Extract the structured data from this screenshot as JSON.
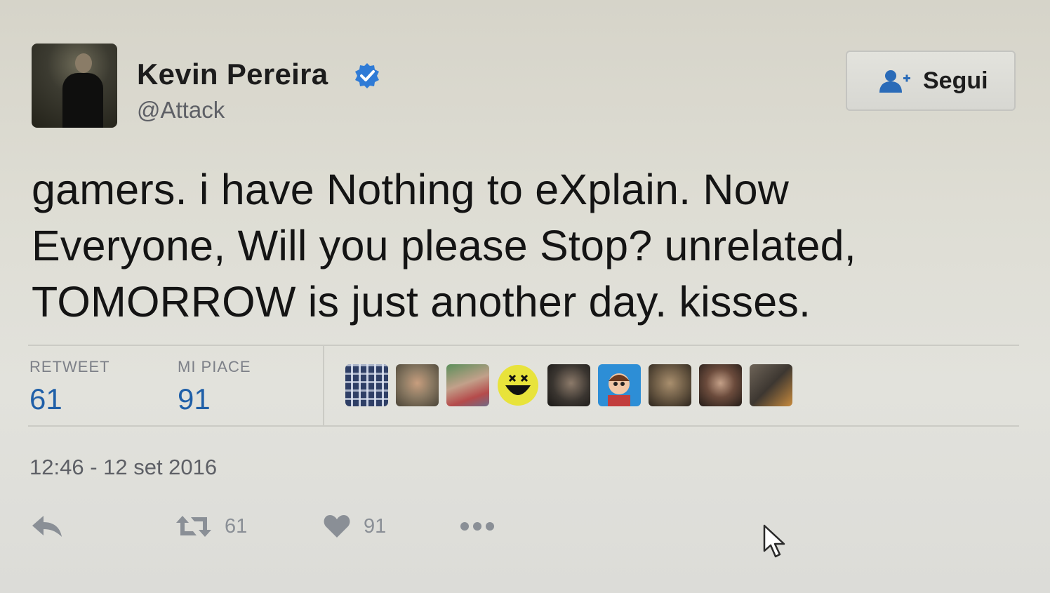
{
  "user": {
    "name": "Kevin Pereira",
    "handle": "@Attack",
    "verified": true
  },
  "follow_button": {
    "label": "Segui",
    "icon": "add-user-icon"
  },
  "tweet": {
    "lines": [
      "gamers. i have Nothing to eXplain. Now",
      "Everyone, Will you please Stop? unrelated,",
      "TOMORROW is just another day. kisses."
    ]
  },
  "stats": {
    "retweet_label": "RETWEET",
    "retweet_count": "61",
    "likes_label": "MI PIACE",
    "likes_count": "91"
  },
  "likers": [
    {
      "icon": "patterned-avatar",
      "bg": "#2f3f66"
    },
    {
      "icon": "man-smiling-avatar",
      "bg": "#8b7a63"
    },
    {
      "icon": "people-avatar",
      "bg": "#a67864"
    },
    {
      "icon": "yellow-smiley-avatar",
      "bg": "#e8e33b"
    },
    {
      "icon": "man-dark-avatar",
      "bg": "#3a3530"
    },
    {
      "icon": "cartoon-character-avatar",
      "bg": "#2d8ed6"
    },
    {
      "icon": "bearded-man-avatar",
      "bg": "#6b5a44"
    },
    {
      "icon": "woman-avatar",
      "bg": "#3b2f2a"
    },
    {
      "icon": "photo-avatar",
      "bg": "#574d45"
    }
  ],
  "timestamp": "12:46 - 12 set 2016",
  "actions": {
    "reply_icon": "reply-icon",
    "retweet_icon": "retweet-icon",
    "retweet_count": "61",
    "like_icon": "heart-icon",
    "like_count": "91",
    "more_icon": "more-dots-icon"
  },
  "colors": {
    "link_blue": "#1f5fa8",
    "verified_blue": "#2f7bd6",
    "muted_text": "#5e6066",
    "icon_gray": "#8a8f96"
  }
}
